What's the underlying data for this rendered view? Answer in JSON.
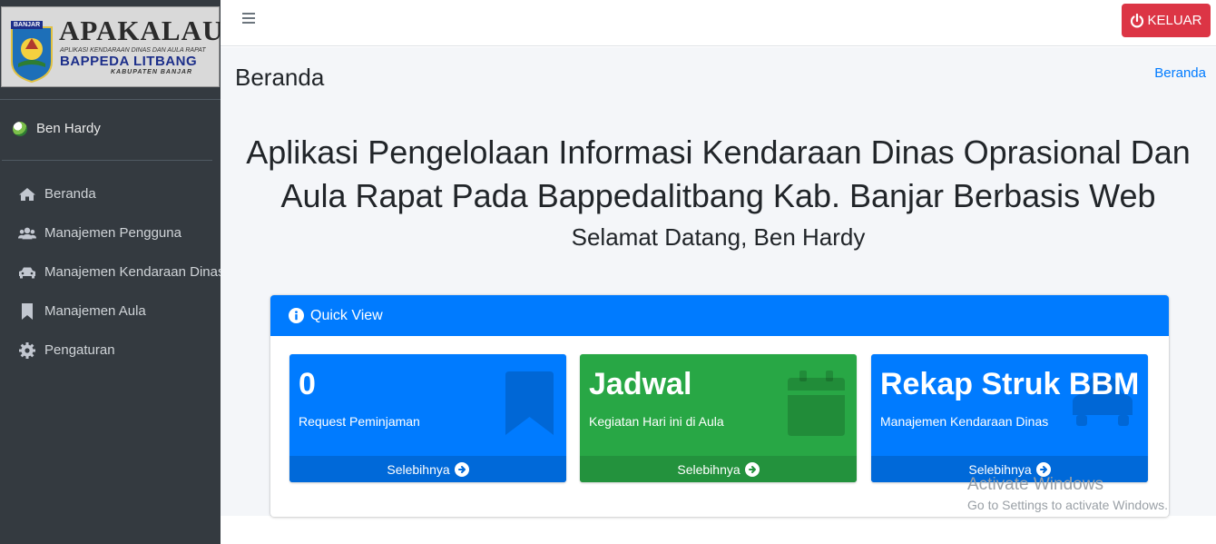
{
  "brand": {
    "tag": "BANJAR",
    "title": "APAKALAU",
    "subtitle": "APLIKASI KENDARAAN DINAS DAN AULA RAPAT",
    "org": "BAPPEDA LITBANG",
    "region": "KABUPATEN BANJAR"
  },
  "user": {
    "name": "Ben Hardy"
  },
  "sidebar": {
    "items": [
      {
        "label": "Beranda",
        "icon": "home-icon"
      },
      {
        "label": "Manajemen Pengguna",
        "icon": "users-icon"
      },
      {
        "label": "Manajemen Kendaraan Dinas",
        "icon": "car-icon"
      },
      {
        "label": "Manajemen Aula",
        "icon": "bookmark-icon"
      },
      {
        "label": "Pengaturan",
        "icon": "gear-icon"
      }
    ]
  },
  "topbar": {
    "logout_label": "KELUAR"
  },
  "page": {
    "title": "Beranda",
    "breadcrumb": "Beranda",
    "headline_line1": "Aplikasi Pengelolaan Informasi Kendaraan Dinas Oprasional Dan",
    "headline_line2": "Aula Rapat Pada Bappedalitbang Kab. Banjar Berbasis Web",
    "welcome": "Selamat Datang, Ben Hardy"
  },
  "quick_view": {
    "title": "Quick View",
    "boxes": [
      {
        "value": "0",
        "label": "Request Peminjaman",
        "link": "Selebihnya",
        "color": "#007bff",
        "icon": "bookmark-icon"
      },
      {
        "value": "Jadwal",
        "label": "Kegiatan Hari ini di Aula",
        "link": "Selebihnya",
        "color": "#28a745",
        "icon": "calendar-icon"
      },
      {
        "value": "Rekap Struk BBM",
        "label": "Manajemen Kendaraan Dinas",
        "link": "Selebihnya",
        "color": "#007bff",
        "icon": "car-icon"
      }
    ]
  },
  "watermark": {
    "line1": "Activate Windows",
    "line2": "Go to Settings to activate Windows."
  }
}
